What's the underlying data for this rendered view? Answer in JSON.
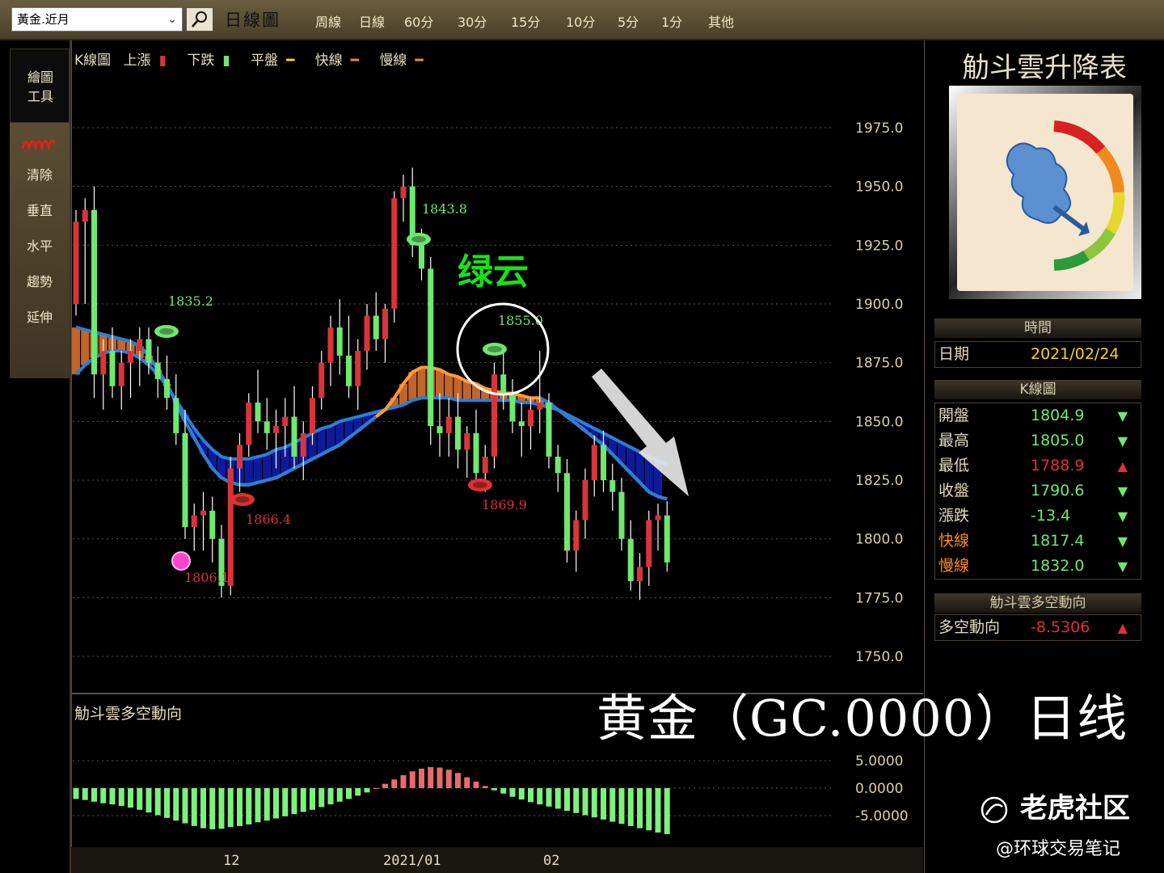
{
  "toolbar": {
    "symbol": "黃金.近月",
    "main_period": "日線圖",
    "periods": [
      "周線",
      "日線",
      "60分",
      "30分",
      "15分",
      "10分",
      "5分",
      "1分",
      "其他"
    ]
  },
  "left_tools": {
    "top": [
      "繪圖",
      "工具"
    ],
    "items": [
      "清除",
      "垂直",
      "水平",
      "趨勢",
      "延伸"
    ]
  },
  "legend": {
    "title": "K線圖",
    "items": [
      "上漲",
      "下跌",
      "平盤",
      "快線",
      "慢線"
    ]
  },
  "colors": {
    "up": "#d9343a",
    "down": "#6fe86f",
    "fast": "#ff8c1a",
    "slow": "#2a7fd4",
    "cloud_bear": "#0d1a9a",
    "cloud_bull": "#c2652b",
    "grid": "#5a5346"
  },
  "annotations": {
    "green_cloud": "绿云",
    "watermark_title": "黄金（GC.0000）日线",
    "price_tags": [
      {
        "text": "1835.2",
        "color": "#6fe86f"
      },
      {
        "text": "1843.8",
        "color": "#6fe86f"
      },
      {
        "text": "1855.0",
        "color": "#6fe86f"
      },
      {
        "text": "1866.4",
        "color": "#e03030"
      },
      {
        "text": "1869.9",
        "color": "#e03030"
      },
      {
        "text": "1806.1",
        "color": "#e03030"
      }
    ]
  },
  "right": {
    "title": "觔斗雲升降表",
    "time_header": "時間",
    "date_label": "日期",
    "date_value": "2021/02/24",
    "k_header": "K線圖",
    "rows": [
      {
        "k": "開盤",
        "v": "1804.9",
        "arrow": "▼",
        "color": "#6fe86f"
      },
      {
        "k": "最高",
        "v": "1805.0",
        "arrow": "▼",
        "color": "#6fe86f"
      },
      {
        "k": "最低",
        "v": "1788.9",
        "arrow": "▲",
        "color": "#e03030"
      },
      {
        "k": "收盤",
        "v": "1790.6",
        "arrow": "▼",
        "color": "#6fe86f"
      },
      {
        "k": "漲跌",
        "v": "-13.4",
        "arrow": "▼",
        "color": "#6fe86f"
      },
      {
        "k": "快線",
        "v": "1817.4",
        "arrow": "▼",
        "color": "#6fe86f",
        "kcolor": "#ff8c1a"
      },
      {
        "k": "慢線",
        "v": "1832.0",
        "arrow": "▼",
        "color": "#6fe86f",
        "kcolor": "#ff8c1a"
      }
    ],
    "trend_header": "觔斗雲多空動向",
    "trend_label": "多空動向",
    "trend_value": "-8.5306",
    "trend_arrow": "▲"
  },
  "sub_chart": {
    "title": "觔斗雲多空動向"
  },
  "branding": {
    "logo": "老虎社区",
    "handle": "@环球交易笔记"
  },
  "chart_data": {
    "type": "candlestick",
    "y_ticks": [
      "1975.0",
      "1950.0",
      "1925.0",
      "1900.0",
      "1875.0",
      "1850.0",
      "1825.0",
      "1800.0",
      "1775.0",
      "1750.0"
    ],
    "ylim": [
      1750,
      1975
    ],
    "x_labels": [
      "12",
      "2021/01",
      "02"
    ],
    "sub_ticks": [
      "5.0000",
      "0.0000",
      "-5.0000"
    ],
    "candles": [
      [
        1900,
        1940,
        1895,
        1935
      ],
      [
        1935,
        1945,
        1900,
        1940
      ],
      [
        1940,
        1950,
        1860,
        1870
      ],
      [
        1870,
        1885,
        1855,
        1880
      ],
      [
        1880,
        1890,
        1860,
        1865
      ],
      [
        1865,
        1880,
        1855,
        1875
      ],
      [
        1875,
        1885,
        1860,
        1880
      ],
      [
        1880,
        1890,
        1865,
        1885
      ],
      [
        1885,
        1890,
        1870,
        1875
      ],
      [
        1875,
        1882,
        1860,
        1868
      ],
      [
        1868,
        1878,
        1855,
        1860
      ],
      [
        1860,
        1870,
        1840,
        1845
      ],
      [
        1845,
        1855,
        1800,
        1805
      ],
      [
        1805,
        1815,
        1795,
        1810
      ],
      [
        1810,
        1820,
        1795,
        1812
      ],
      [
        1812,
        1818,
        1790,
        1800
      ],
      [
        1800,
        1806,
        1775,
        1780
      ],
      [
        1780,
        1835,
        1776,
        1830
      ],
      [
        1830,
        1845,
        1820,
        1840
      ],
      [
        1840,
        1862,
        1835,
        1858
      ],
      [
        1858,
        1872,
        1845,
        1850
      ],
      [
        1850,
        1860,
        1838,
        1845
      ],
      [
        1845,
        1855,
        1830,
        1848
      ],
      [
        1848,
        1860,
        1835,
        1852
      ],
      [
        1852,
        1865,
        1830,
        1835
      ],
      [
        1835,
        1850,
        1825,
        1845
      ],
      [
        1845,
        1865,
        1840,
        1860
      ],
      [
        1860,
        1880,
        1855,
        1875
      ],
      [
        1875,
        1895,
        1865,
        1890
      ],
      [
        1890,
        1902,
        1870,
        1878
      ],
      [
        1878,
        1895,
        1860,
        1865
      ],
      [
        1865,
        1885,
        1855,
        1880
      ],
      [
        1880,
        1900,
        1872,
        1895
      ],
      [
        1895,
        1905,
        1880,
        1885
      ],
      [
        1885,
        1900,
        1875,
        1898
      ],
      [
        1898,
        1948,
        1892,
        1945
      ],
      [
        1945,
        1955,
        1935,
        1950
      ],
      [
        1950,
        1958,
        1920,
        1925
      ],
      [
        1925,
        1932,
        1910,
        1915
      ],
      [
        1915,
        1920,
        1840,
        1848
      ],
      [
        1848,
        1862,
        1835,
        1845
      ],
      [
        1845,
        1860,
        1835,
        1852
      ],
      [
        1852,
        1862,
        1830,
        1838
      ],
      [
        1838,
        1848,
        1826,
        1845
      ],
      [
        1845,
        1855,
        1822,
        1828
      ],
      [
        1828,
        1840,
        1820,
        1835
      ],
      [
        1835,
        1875,
        1830,
        1870
      ],
      [
        1870,
        1882,
        1855,
        1862
      ],
      [
        1862,
        1868,
        1845,
        1850
      ],
      [
        1850,
        1858,
        1835,
        1848
      ],
      [
        1848,
        1860,
        1838,
        1855
      ],
      [
        1855,
        1880,
        1845,
        1858
      ],
      [
        1858,
        1862,
        1830,
        1835
      ],
      [
        1835,
        1840,
        1820,
        1828
      ],
      [
        1828,
        1834,
        1790,
        1795
      ],
      [
        1795,
        1812,
        1786,
        1808
      ],
      [
        1808,
        1830,
        1800,
        1825
      ],
      [
        1825,
        1844,
        1818,
        1840
      ],
      [
        1840,
        1846,
        1820,
        1825
      ],
      [
        1825,
        1832,
        1812,
        1820
      ],
      [
        1820,
        1826,
        1795,
        1800
      ],
      [
        1800,
        1808,
        1778,
        1782
      ],
      [
        1782,
        1794,
        1774,
        1788
      ],
      [
        1788,
        1812,
        1780,
        1808
      ],
      [
        1808,
        1815,
        1795,
        1810
      ],
      [
        1810,
        1816,
        1786,
        1790
      ]
    ],
    "fast": [
      1890,
      1889,
      1888,
      1887,
      1886,
      1885,
      1884,
      1882,
      1878,
      1872,
      1866,
      1858,
      1850,
      1843,
      1836,
      1830,
      1826,
      1824,
      1823,
      1823,
      1824,
      1825,
      1826,
      1828,
      1830,
      1832,
      1834,
      1836,
      1838,
      1840,
      1843,
      1846,
      1849,
      1852,
      1855,
      1860,
      1866,
      1871,
      1873,
      1873,
      1872,
      1870,
      1869,
      1867,
      1866,
      1864,
      1863,
      1862,
      1862,
      1861,
      1860,
      1860,
      1858,
      1855,
      1852,
      1849,
      1846,
      1843,
      1840,
      1836,
      1832,
      1828,
      1824,
      1820,
      1818,
      1817
    ],
    "slow": [
      1870,
      1874,
      1877,
      1879,
      1880,
      1880,
      1879,
      1877,
      1874,
      1870,
      1865,
      1859,
      1853,
      1847,
      1842,
      1838,
      1835,
      1834,
      1834,
      1834,
      1835,
      1836,
      1838,
      1839,
      1841,
      1843,
      1845,
      1847,
      1848,
      1850,
      1851,
      1852,
      1853,
      1854,
      1855,
      1856,
      1857,
      1859,
      1860,
      1860,
      1860,
      1860,
      1859,
      1859,
      1859,
      1859,
      1859,
      1859,
      1859,
      1858,
      1858,
      1857,
      1856,
      1855,
      1853,
      1851,
      1849,
      1847,
      1845,
      1843,
      1841,
      1839,
      1837,
      1835,
      1833,
      1832
    ],
    "momentum": [
      -2,
      -2.2,
      -2.5,
      -2.8,
      -3,
      -3.3,
      -3.6,
      -4,
      -4.5,
      -5,
      -5.5,
      -6,
      -6.5,
      -7,
      -7.4,
      -7.6,
      -7.5,
      -7.2,
      -7,
      -6.7,
      -6.3,
      -6,
      -5.6,
      -5.2,
      -4.8,
      -4.4,
      -4,
      -3.5,
      -3,
      -2.5,
      -2,
      -1.4,
      -0.8,
      0,
      0.8,
      1.6,
      2.4,
      3.1,
      3.6,
      3.9,
      3.8,
      3.4,
      2.8,
      2,
      1.2,
      0.4,
      -0.4,
      -1,
      -1.6,
      -2.1,
      -2.6,
      -3,
      -3.4,
      -3.8,
      -4.2,
      -4.6,
      -5,
      -5.4,
      -5.8,
      -6.2,
      -6.6,
      -7,
      -7.4,
      -7.8,
      -8.2,
      -8.5
    ]
  }
}
